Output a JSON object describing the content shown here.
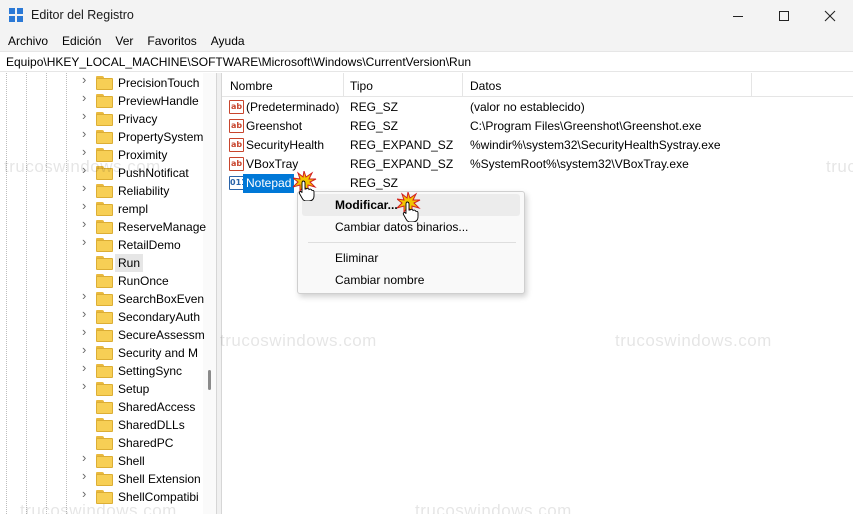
{
  "window": {
    "title": "Editor del Registro"
  },
  "menu": [
    "Archivo",
    "Edición",
    "Ver",
    "Favoritos",
    "Ayuda"
  ],
  "address": "Equipo\\HKEY_LOCAL_MACHINE\\SOFTWARE\\Microsoft\\Windows\\CurrentVersion\\Run",
  "tree": {
    "items": [
      {
        "label": "PrecisionTouch",
        "expandable": true
      },
      {
        "label": "PreviewHandle",
        "expandable": true
      },
      {
        "label": "Privacy",
        "expandable": true
      },
      {
        "label": "PropertySystem",
        "expandable": true
      },
      {
        "label": "Proximity",
        "expandable": true
      },
      {
        "label": "PushNotificat",
        "expandable": true
      },
      {
        "label": "Reliability",
        "expandable": true
      },
      {
        "label": "rempl",
        "expandable": true
      },
      {
        "label": "ReserveManage",
        "expandable": true
      },
      {
        "label": "RetailDemo",
        "expandable": true
      },
      {
        "label": "Run",
        "expandable": false,
        "selected": true
      },
      {
        "label": "RunOnce",
        "expandable": false
      },
      {
        "label": "SearchBoxEven",
        "expandable": true
      },
      {
        "label": "SecondaryAuth",
        "expandable": true
      },
      {
        "label": "SecureAssessm",
        "expandable": true
      },
      {
        "label": "Security and M",
        "expandable": true
      },
      {
        "label": "SettingSync",
        "expandable": true
      },
      {
        "label": "Setup",
        "expandable": true
      },
      {
        "label": "SharedAccess",
        "expandable": false
      },
      {
        "label": "SharedDLLs",
        "expandable": false
      },
      {
        "label": "SharedPC",
        "expandable": false
      },
      {
        "label": "Shell",
        "expandable": true
      },
      {
        "label": "Shell Extension",
        "expandable": true
      },
      {
        "label": "ShellCompatibi",
        "expandable": true
      }
    ]
  },
  "list": {
    "columns": [
      "Nombre",
      "Tipo",
      "Datos"
    ],
    "rows": [
      {
        "name": "(Predeterminado)",
        "type": "REG_SZ",
        "data": "(valor no establecido)",
        "icon": "string-value-icon"
      },
      {
        "name": "Greenshot",
        "type": "REG_SZ",
        "data": "C:\\Program Files\\Greenshot\\Greenshot.exe",
        "icon": "string-value-icon"
      },
      {
        "name": "SecurityHealth",
        "type": "REG_EXPAND_SZ",
        "data": "%windir%\\system32\\SecurityHealthSystray.exe",
        "icon": "string-value-icon"
      },
      {
        "name": "VBoxTray",
        "type": "REG_EXPAND_SZ",
        "data": "%SystemRoot%\\system32\\VBoxTray.exe",
        "icon": "string-value-icon"
      },
      {
        "name": "Notepad",
        "type": "REG_SZ",
        "data": "",
        "icon": "binary-value-icon",
        "selected": true
      }
    ]
  },
  "context_menu": {
    "items": [
      "Modificar...",
      "Cambiar datos binarios...",
      "Eliminar",
      "Cambiar nombre"
    ],
    "highlighted": "Modificar..."
  },
  "watermark": "trucoswindows.com",
  "colors": {
    "selection": "#0078d7",
    "folder": "#f7cf55",
    "click_burst": "#f2c500"
  }
}
